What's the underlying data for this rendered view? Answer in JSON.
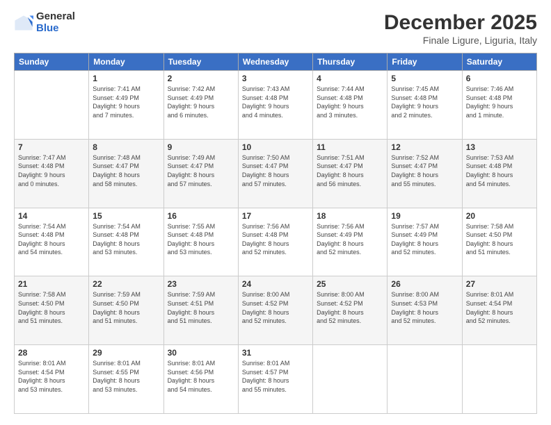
{
  "logo": {
    "general": "General",
    "blue": "Blue"
  },
  "header": {
    "title": "December 2025",
    "subtitle": "Finale Ligure, Liguria, Italy"
  },
  "days_of_week": [
    "Sunday",
    "Monday",
    "Tuesday",
    "Wednesday",
    "Thursday",
    "Friday",
    "Saturday"
  ],
  "weeks": [
    [
      {
        "day": "",
        "info": ""
      },
      {
        "day": "1",
        "info": "Sunrise: 7:41 AM\nSunset: 4:49 PM\nDaylight: 9 hours\nand 7 minutes."
      },
      {
        "day": "2",
        "info": "Sunrise: 7:42 AM\nSunset: 4:49 PM\nDaylight: 9 hours\nand 6 minutes."
      },
      {
        "day": "3",
        "info": "Sunrise: 7:43 AM\nSunset: 4:48 PM\nDaylight: 9 hours\nand 4 minutes."
      },
      {
        "day": "4",
        "info": "Sunrise: 7:44 AM\nSunset: 4:48 PM\nDaylight: 9 hours\nand 3 minutes."
      },
      {
        "day": "5",
        "info": "Sunrise: 7:45 AM\nSunset: 4:48 PM\nDaylight: 9 hours\nand 2 minutes."
      },
      {
        "day": "6",
        "info": "Sunrise: 7:46 AM\nSunset: 4:48 PM\nDaylight: 9 hours\nand 1 minute."
      }
    ],
    [
      {
        "day": "7",
        "info": "Sunrise: 7:47 AM\nSunset: 4:48 PM\nDaylight: 9 hours\nand 0 minutes."
      },
      {
        "day": "8",
        "info": "Sunrise: 7:48 AM\nSunset: 4:47 PM\nDaylight: 8 hours\nand 58 minutes."
      },
      {
        "day": "9",
        "info": "Sunrise: 7:49 AM\nSunset: 4:47 PM\nDaylight: 8 hours\nand 57 minutes."
      },
      {
        "day": "10",
        "info": "Sunrise: 7:50 AM\nSunset: 4:47 PM\nDaylight: 8 hours\nand 57 minutes."
      },
      {
        "day": "11",
        "info": "Sunrise: 7:51 AM\nSunset: 4:47 PM\nDaylight: 8 hours\nand 56 minutes."
      },
      {
        "day": "12",
        "info": "Sunrise: 7:52 AM\nSunset: 4:47 PM\nDaylight: 8 hours\nand 55 minutes."
      },
      {
        "day": "13",
        "info": "Sunrise: 7:53 AM\nSunset: 4:48 PM\nDaylight: 8 hours\nand 54 minutes."
      }
    ],
    [
      {
        "day": "14",
        "info": "Sunrise: 7:54 AM\nSunset: 4:48 PM\nDaylight: 8 hours\nand 54 minutes."
      },
      {
        "day": "15",
        "info": "Sunrise: 7:54 AM\nSunset: 4:48 PM\nDaylight: 8 hours\nand 53 minutes."
      },
      {
        "day": "16",
        "info": "Sunrise: 7:55 AM\nSunset: 4:48 PM\nDaylight: 8 hours\nand 53 minutes."
      },
      {
        "day": "17",
        "info": "Sunrise: 7:56 AM\nSunset: 4:48 PM\nDaylight: 8 hours\nand 52 minutes."
      },
      {
        "day": "18",
        "info": "Sunrise: 7:56 AM\nSunset: 4:49 PM\nDaylight: 8 hours\nand 52 minutes."
      },
      {
        "day": "19",
        "info": "Sunrise: 7:57 AM\nSunset: 4:49 PM\nDaylight: 8 hours\nand 52 minutes."
      },
      {
        "day": "20",
        "info": "Sunrise: 7:58 AM\nSunset: 4:50 PM\nDaylight: 8 hours\nand 51 minutes."
      }
    ],
    [
      {
        "day": "21",
        "info": "Sunrise: 7:58 AM\nSunset: 4:50 PM\nDaylight: 8 hours\nand 51 minutes."
      },
      {
        "day": "22",
        "info": "Sunrise: 7:59 AM\nSunset: 4:50 PM\nDaylight: 8 hours\nand 51 minutes."
      },
      {
        "day": "23",
        "info": "Sunrise: 7:59 AM\nSunset: 4:51 PM\nDaylight: 8 hours\nand 51 minutes."
      },
      {
        "day": "24",
        "info": "Sunrise: 8:00 AM\nSunset: 4:52 PM\nDaylight: 8 hours\nand 52 minutes."
      },
      {
        "day": "25",
        "info": "Sunrise: 8:00 AM\nSunset: 4:52 PM\nDaylight: 8 hours\nand 52 minutes."
      },
      {
        "day": "26",
        "info": "Sunrise: 8:00 AM\nSunset: 4:53 PM\nDaylight: 8 hours\nand 52 minutes."
      },
      {
        "day": "27",
        "info": "Sunrise: 8:01 AM\nSunset: 4:54 PM\nDaylight: 8 hours\nand 52 minutes."
      }
    ],
    [
      {
        "day": "28",
        "info": "Sunrise: 8:01 AM\nSunset: 4:54 PM\nDaylight: 8 hours\nand 53 minutes."
      },
      {
        "day": "29",
        "info": "Sunrise: 8:01 AM\nSunset: 4:55 PM\nDaylight: 8 hours\nand 53 minutes."
      },
      {
        "day": "30",
        "info": "Sunrise: 8:01 AM\nSunset: 4:56 PM\nDaylight: 8 hours\nand 54 minutes."
      },
      {
        "day": "31",
        "info": "Sunrise: 8:01 AM\nSunset: 4:57 PM\nDaylight: 8 hours\nand 55 minutes."
      },
      {
        "day": "",
        "info": ""
      },
      {
        "day": "",
        "info": ""
      },
      {
        "day": "",
        "info": ""
      }
    ]
  ]
}
